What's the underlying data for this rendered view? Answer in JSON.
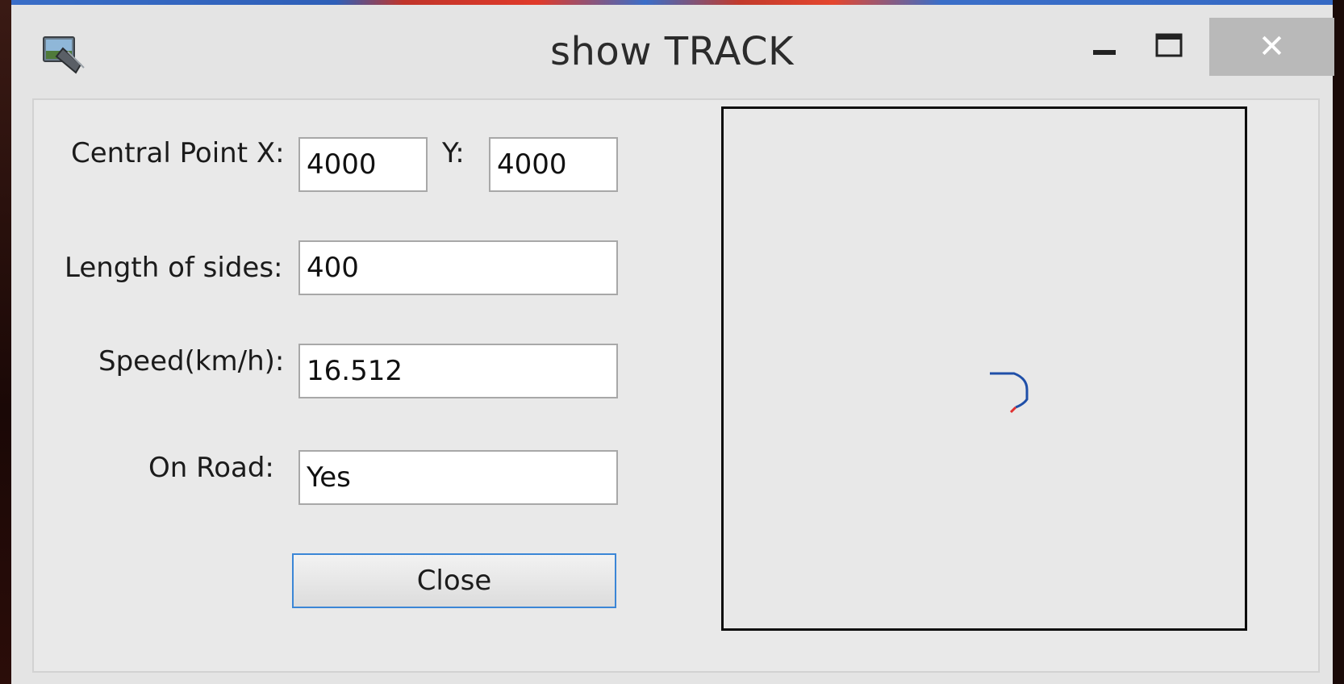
{
  "window": {
    "title": "show TRACK",
    "icons": {
      "app": "monitor-track-icon",
      "minimize": "minimize-icon",
      "maximize": "maximize-icon",
      "close": "close-icon"
    },
    "close_glyph": "✕"
  },
  "form": {
    "central_x_label": "Central Point X:",
    "central_x_value": "4000",
    "central_y_label": "Y:",
    "central_y_value": "4000",
    "length_label": "Length of sides:",
    "length_value": "400",
    "speed_label": "Speed(km/h):",
    "speed_value": "16.512",
    "on_road_label": "On Road:",
    "on_road_value": "Yes",
    "close_label": "Close"
  },
  "track_view": {
    "track_color": "#1f4fa8",
    "current_position_color": "#e03030"
  }
}
